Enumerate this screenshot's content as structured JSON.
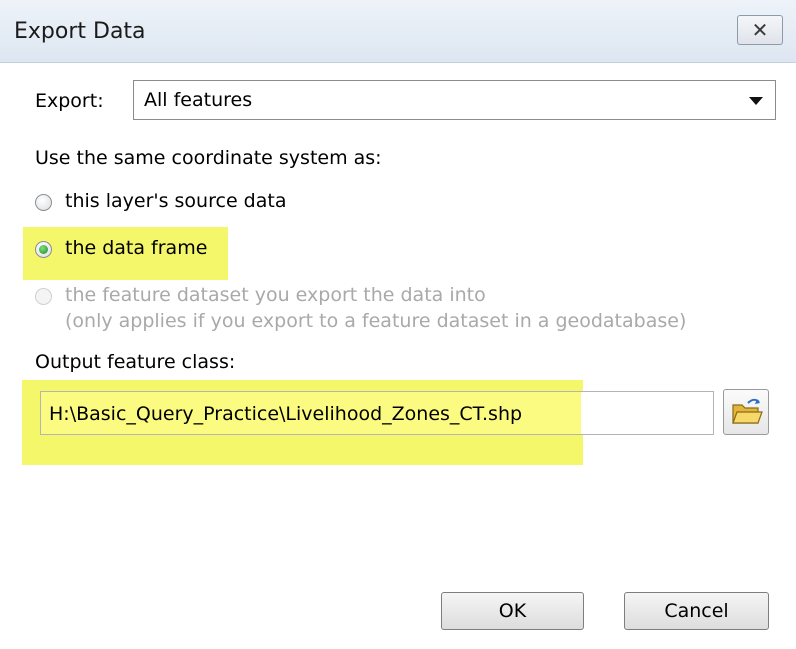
{
  "window": {
    "title": "Export Data",
    "close_glyph": "✕"
  },
  "export": {
    "label": "Export:",
    "selected": "All features"
  },
  "coordinate_system": {
    "heading": "Use the same coordinate system as:",
    "options": [
      {
        "label": "this layer's source data",
        "checked": false,
        "enabled": true
      },
      {
        "label": "the data frame",
        "checked": true,
        "enabled": true
      },
      {
        "label": "the feature dataset you export the data into",
        "sublabel": "(only applies if you export to a feature dataset in a geodatabase)",
        "checked": false,
        "enabled": false
      }
    ]
  },
  "output": {
    "label": "Output feature class:",
    "path": "H:\\Basic_Query_Practice\\Livelihood_Zones_CT.shp",
    "browse_icon": "folder-open-icon"
  },
  "buttons": {
    "ok": "OK",
    "cancel": "Cancel"
  },
  "colors": {
    "highlight": "#f5f76a",
    "radio_checked": "#1c8a1c"
  }
}
